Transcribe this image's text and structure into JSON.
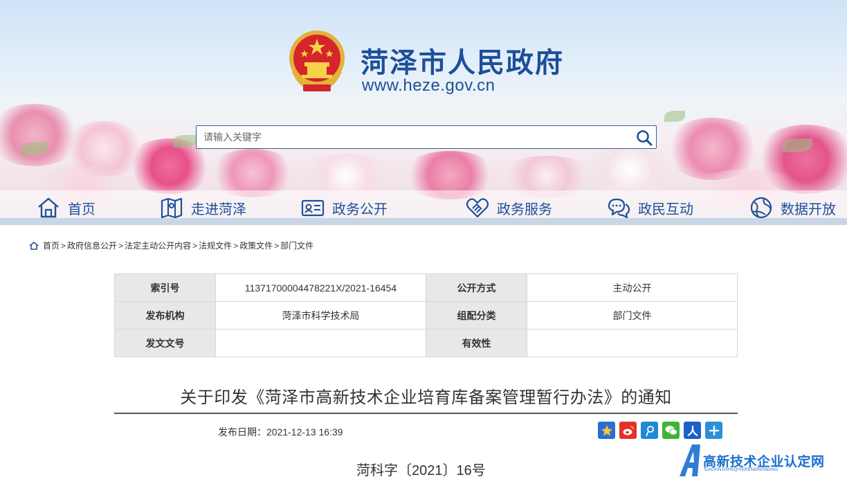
{
  "header": {
    "site_title": "菏泽市人民政府",
    "site_url": "www.heze.gov.cn",
    "search_placeholder": "请输入关键字"
  },
  "nav": {
    "items": [
      {
        "label": "首页",
        "icon": "home-icon"
      },
      {
        "label": "走进菏泽",
        "icon": "map-icon"
      },
      {
        "label": "政务公开",
        "icon": "id-card-icon"
      },
      {
        "label": "政务服务",
        "icon": "handshake-icon"
      },
      {
        "label": "政民互动",
        "icon": "chat-bubbles-icon"
      },
      {
        "label": "数据开放",
        "icon": "globe-icon"
      }
    ]
  },
  "breadcrumb": [
    "首页",
    "政府信息公开",
    "法定主动公开内容",
    "法规文件",
    "政策文件",
    "部门文件"
  ],
  "info": {
    "index_label": "索引号",
    "index_value": "11371700004478221X/2021-16454",
    "open_mode_label": "公开方式",
    "open_mode_value": "主动公开",
    "publisher_label": "发布机构",
    "publisher_value": "菏泽市科学技术局",
    "category_label": "组配分类",
    "category_value": "部门文件",
    "doc_no_label": "发文文号",
    "doc_no_value": "",
    "validity_label": "有效性",
    "validity_value": ""
  },
  "document": {
    "title": "关于印发《菏泽市高新技术企业培育库备案管理暂行办法》的通知",
    "publish_date": "发布日期：2021-12-13 16:39",
    "doc_number": "菏科字〔2021〕16号"
  },
  "share": [
    "favorite-star-icon",
    "weibo-icon",
    "tencent-weibo-icon",
    "wechat-icon",
    "renren-icon",
    "more-plus-icon"
  ],
  "watermark": {
    "text": "高新技术企业认定网",
    "sub": "GAOXINJISHUQIYERENDINGWANG"
  },
  "colors": {
    "brand_blue": "#1d4f98",
    "table_header_bg": "#e8e8e8",
    "watermark_blue": "#1a6fd0"
  }
}
